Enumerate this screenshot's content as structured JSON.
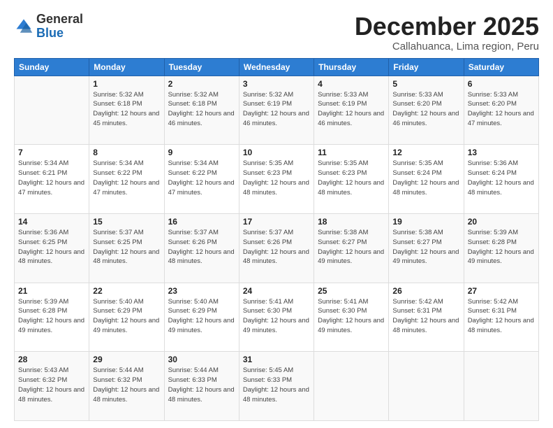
{
  "logo": {
    "general": "General",
    "blue": "Blue"
  },
  "title": "December 2025",
  "subtitle": "Callahuanca, Lima region, Peru",
  "weekdays": [
    "Sunday",
    "Monday",
    "Tuesday",
    "Wednesday",
    "Thursday",
    "Friday",
    "Saturday"
  ],
  "weeks": [
    [
      {
        "day": "",
        "sunrise": "",
        "sunset": "",
        "daylight": ""
      },
      {
        "day": "1",
        "sunrise": "Sunrise: 5:32 AM",
        "sunset": "Sunset: 6:18 PM",
        "daylight": "Daylight: 12 hours and 45 minutes."
      },
      {
        "day": "2",
        "sunrise": "Sunrise: 5:32 AM",
        "sunset": "Sunset: 6:18 PM",
        "daylight": "Daylight: 12 hours and 46 minutes."
      },
      {
        "day": "3",
        "sunrise": "Sunrise: 5:32 AM",
        "sunset": "Sunset: 6:19 PM",
        "daylight": "Daylight: 12 hours and 46 minutes."
      },
      {
        "day": "4",
        "sunrise": "Sunrise: 5:33 AM",
        "sunset": "Sunset: 6:19 PM",
        "daylight": "Daylight: 12 hours and 46 minutes."
      },
      {
        "day": "5",
        "sunrise": "Sunrise: 5:33 AM",
        "sunset": "Sunset: 6:20 PM",
        "daylight": "Daylight: 12 hours and 46 minutes."
      },
      {
        "day": "6",
        "sunrise": "Sunrise: 5:33 AM",
        "sunset": "Sunset: 6:20 PM",
        "daylight": "Daylight: 12 hours and 47 minutes."
      }
    ],
    [
      {
        "day": "7",
        "sunrise": "Sunrise: 5:34 AM",
        "sunset": "Sunset: 6:21 PM",
        "daylight": "Daylight: 12 hours and 47 minutes."
      },
      {
        "day": "8",
        "sunrise": "Sunrise: 5:34 AM",
        "sunset": "Sunset: 6:22 PM",
        "daylight": "Daylight: 12 hours and 47 minutes."
      },
      {
        "day": "9",
        "sunrise": "Sunrise: 5:34 AM",
        "sunset": "Sunset: 6:22 PM",
        "daylight": "Daylight: 12 hours and 47 minutes."
      },
      {
        "day": "10",
        "sunrise": "Sunrise: 5:35 AM",
        "sunset": "Sunset: 6:23 PM",
        "daylight": "Daylight: 12 hours and 48 minutes."
      },
      {
        "day": "11",
        "sunrise": "Sunrise: 5:35 AM",
        "sunset": "Sunset: 6:23 PM",
        "daylight": "Daylight: 12 hours and 48 minutes."
      },
      {
        "day": "12",
        "sunrise": "Sunrise: 5:35 AM",
        "sunset": "Sunset: 6:24 PM",
        "daylight": "Daylight: 12 hours and 48 minutes."
      },
      {
        "day": "13",
        "sunrise": "Sunrise: 5:36 AM",
        "sunset": "Sunset: 6:24 PM",
        "daylight": "Daylight: 12 hours and 48 minutes."
      }
    ],
    [
      {
        "day": "14",
        "sunrise": "Sunrise: 5:36 AM",
        "sunset": "Sunset: 6:25 PM",
        "daylight": "Daylight: 12 hours and 48 minutes."
      },
      {
        "day": "15",
        "sunrise": "Sunrise: 5:37 AM",
        "sunset": "Sunset: 6:25 PM",
        "daylight": "Daylight: 12 hours and 48 minutes."
      },
      {
        "day": "16",
        "sunrise": "Sunrise: 5:37 AM",
        "sunset": "Sunset: 6:26 PM",
        "daylight": "Daylight: 12 hours and 48 minutes."
      },
      {
        "day": "17",
        "sunrise": "Sunrise: 5:37 AM",
        "sunset": "Sunset: 6:26 PM",
        "daylight": "Daylight: 12 hours and 48 minutes."
      },
      {
        "day": "18",
        "sunrise": "Sunrise: 5:38 AM",
        "sunset": "Sunset: 6:27 PM",
        "daylight": "Daylight: 12 hours and 49 minutes."
      },
      {
        "day": "19",
        "sunrise": "Sunrise: 5:38 AM",
        "sunset": "Sunset: 6:27 PM",
        "daylight": "Daylight: 12 hours and 49 minutes."
      },
      {
        "day": "20",
        "sunrise": "Sunrise: 5:39 AM",
        "sunset": "Sunset: 6:28 PM",
        "daylight": "Daylight: 12 hours and 49 minutes."
      }
    ],
    [
      {
        "day": "21",
        "sunrise": "Sunrise: 5:39 AM",
        "sunset": "Sunset: 6:28 PM",
        "daylight": "Daylight: 12 hours and 49 minutes."
      },
      {
        "day": "22",
        "sunrise": "Sunrise: 5:40 AM",
        "sunset": "Sunset: 6:29 PM",
        "daylight": "Daylight: 12 hours and 49 minutes."
      },
      {
        "day": "23",
        "sunrise": "Sunrise: 5:40 AM",
        "sunset": "Sunset: 6:29 PM",
        "daylight": "Daylight: 12 hours and 49 minutes."
      },
      {
        "day": "24",
        "sunrise": "Sunrise: 5:41 AM",
        "sunset": "Sunset: 6:30 PM",
        "daylight": "Daylight: 12 hours and 49 minutes."
      },
      {
        "day": "25",
        "sunrise": "Sunrise: 5:41 AM",
        "sunset": "Sunset: 6:30 PM",
        "daylight": "Daylight: 12 hours and 49 minutes."
      },
      {
        "day": "26",
        "sunrise": "Sunrise: 5:42 AM",
        "sunset": "Sunset: 6:31 PM",
        "daylight": "Daylight: 12 hours and 48 minutes."
      },
      {
        "day": "27",
        "sunrise": "Sunrise: 5:42 AM",
        "sunset": "Sunset: 6:31 PM",
        "daylight": "Daylight: 12 hours and 48 minutes."
      }
    ],
    [
      {
        "day": "28",
        "sunrise": "Sunrise: 5:43 AM",
        "sunset": "Sunset: 6:32 PM",
        "daylight": "Daylight: 12 hours and 48 minutes."
      },
      {
        "day": "29",
        "sunrise": "Sunrise: 5:44 AM",
        "sunset": "Sunset: 6:32 PM",
        "daylight": "Daylight: 12 hours and 48 minutes."
      },
      {
        "day": "30",
        "sunrise": "Sunrise: 5:44 AM",
        "sunset": "Sunset: 6:33 PM",
        "daylight": "Daylight: 12 hours and 48 minutes."
      },
      {
        "day": "31",
        "sunrise": "Sunrise: 5:45 AM",
        "sunset": "Sunset: 6:33 PM",
        "daylight": "Daylight: 12 hours and 48 minutes."
      },
      {
        "day": "",
        "sunrise": "",
        "sunset": "",
        "daylight": ""
      },
      {
        "day": "",
        "sunrise": "",
        "sunset": "",
        "daylight": ""
      },
      {
        "day": "",
        "sunrise": "",
        "sunset": "",
        "daylight": ""
      }
    ]
  ]
}
